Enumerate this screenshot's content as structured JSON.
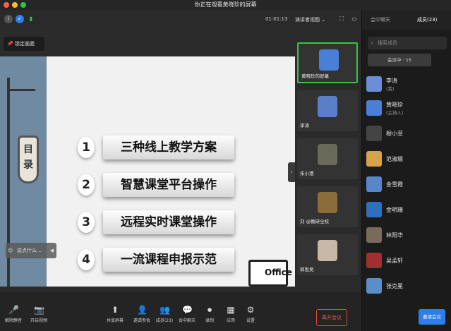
{
  "window": {
    "title": "你正在观看黄晓珍的屏幕"
  },
  "topbar": {
    "timer": "01:01:13",
    "view_mode": "演讲者视图 ⌄"
  },
  "stage": {
    "focus_label": "锁定画面",
    "chat_placeholder": "说点什么...",
    "toc_chars": [
      "目",
      "录"
    ],
    "items": [
      {
        "num": "1",
        "text": "三种线上教学方案"
      },
      {
        "num": "2",
        "text": "智慧课堂平台操作"
      },
      {
        "num": "3",
        "text": "远程实时课堂操作"
      },
      {
        "num": "4",
        "text": "一流课程申报示范"
      }
    ],
    "logo_text": "Office"
  },
  "gallery": {
    "tiles": [
      {
        "label": "黄晓珍的屏幕",
        "color": "#4a7fd8",
        "active": true
      },
      {
        "label": "李涛",
        "color": "#5a7fc8"
      },
      {
        "label": "朱小港",
        "color": "#6a6a5a"
      },
      {
        "label": "刘 @教研全校",
        "color": "#8a6d3b"
      },
      {
        "label": "郭思吴",
        "color": "#c7b7a6"
      }
    ]
  },
  "bottombar": {
    "items": [
      {
        "label": "解除静音",
        "icon": "🎤"
      },
      {
        "label": "开启视频",
        "icon": "📷"
      },
      {
        "label": "共享屏幕",
        "icon": "⬆"
      },
      {
        "label": "邀请参会",
        "icon": "👤"
      },
      {
        "label": "成员(23)",
        "icon": "👥"
      },
      {
        "label": "会中聊天",
        "icon": "💬"
      },
      {
        "label": "录制",
        "icon": "⏺"
      },
      {
        "label": "应用",
        "icon": "▦"
      },
      {
        "label": "设置",
        "icon": "⚙"
      }
    ],
    "end_label": "离开会议"
  },
  "panel": {
    "tab_label": "会中聊天",
    "members_label": "成员(23)",
    "search_placeholder": "搜索成员",
    "in_meeting_tab": "会议中 · 15",
    "members": [
      {
        "name": "李涛",
        "role": "(我)",
        "color": "#6b8ed6"
      },
      {
        "name": "黄晓珍",
        "role": "(主持人)",
        "color": "#4a7fd8"
      },
      {
        "name": "穆小菲",
        "role": "",
        "color": "#444"
      },
      {
        "name": "范淑颖",
        "role": "",
        "color": "#d8a24a"
      },
      {
        "name": "金雪霞",
        "role": "",
        "color": "#5a86c9"
      },
      {
        "name": "金明珊",
        "role": "",
        "color": "#2f6fbf"
      },
      {
        "name": "林阳华",
        "role": "",
        "color": "#7a6a5a"
      },
      {
        "name": "吴孟轩",
        "role": "",
        "color": "#a03030"
      },
      {
        "name": "张克冕",
        "role": "",
        "color": "#5a8ec9"
      }
    ],
    "invite_label": "邀请会议"
  }
}
